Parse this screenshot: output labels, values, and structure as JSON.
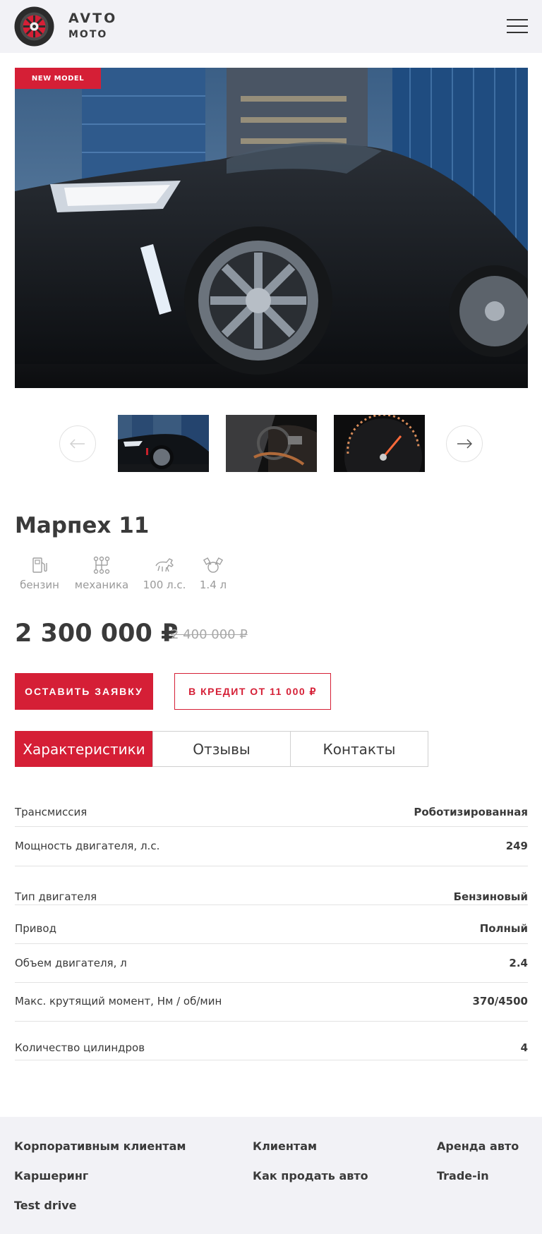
{
  "header": {
    "brand_top": "AVTO",
    "brand_bottom": "MOTO",
    "logo_icon": "wheel-icon",
    "menu_icon": "hamburger-menu-icon"
  },
  "gallery": {
    "badge": "NEW MODEL",
    "prev_icon": "arrow-left-icon",
    "next_icon": "arrow-right-icon",
    "thumbnails": [
      "car-exterior-thumbnail",
      "car-interior-thumbnail",
      "speedometer-thumbnail"
    ]
  },
  "product": {
    "title": "Марпех 11",
    "specs": [
      {
        "icon": "fuel-pump-icon",
        "label": "бензин"
      },
      {
        "icon": "gearbox-icon",
        "label": "механика"
      },
      {
        "icon": "horse-icon",
        "label": "100 л.с."
      },
      {
        "icon": "engine-icon",
        "label": "1.4 л"
      }
    ],
    "price": "2 300 000 ₽",
    "old_price": "2 400 000 ₽"
  },
  "actions": {
    "request_label": "ОСТАВИТЬ ЗАЯВКУ",
    "credit_label": "В КРЕДИТ ОТ 11 000 ₽"
  },
  "tabs": [
    {
      "label": "Характеристики",
      "active": true
    },
    {
      "label": "Отзывы",
      "active": false
    },
    {
      "label": "Контакты",
      "active": false
    }
  ],
  "characteristics": [
    {
      "name": "Трансмиссия",
      "value": "Роботизированная"
    },
    {
      "name": "Мощность двигателя, л.с.",
      "value": "249"
    },
    {
      "name": "Тип двигателя",
      "value": "Бензиновый"
    },
    {
      "name": "Привод",
      "value": "Полный"
    },
    {
      "name": "Объем двигателя, л",
      "value": "2.4"
    },
    {
      "name": "Макс. крутящий момент, Нм / об/мин",
      "value": "370/4500"
    },
    {
      "name": "Количество цилиндров",
      "value": "4"
    }
  ],
  "footer": {
    "links": [
      "Корпоративным клиентам",
      "Клиентам",
      "Аренда авто",
      "Каршеринг",
      "Как продать авто",
      "Trade-in",
      "Test drive"
    ]
  },
  "colors": {
    "accent": "#d51f36",
    "header_bg": "#f2f2f6",
    "text": "#3a3a3a",
    "muted": "#9a9a9a"
  }
}
